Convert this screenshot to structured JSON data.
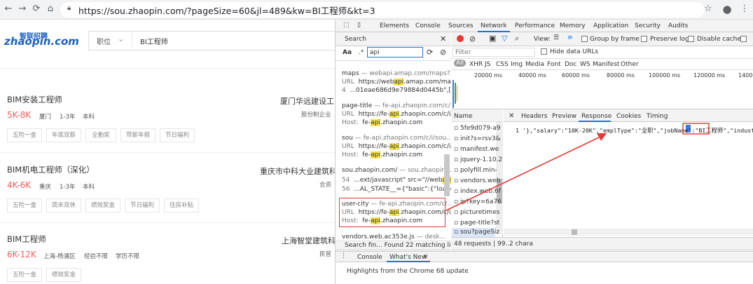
{
  "browser": {
    "url": "https://sou.zhaopin.com/?pageSize=60&jl=489&kw=BI工程师&kt=3"
  },
  "site": {
    "logo_main": "zhaopin.com",
    "logo_cn": "智联招聘",
    "search_category": "职位",
    "search_keyword": "BI工程师"
  },
  "jobs": [
    {
      "title": "BIM安装工程师",
      "salary": "5K-8K",
      "city": "厦门",
      "exp": "1-3年",
      "edu": "本科",
      "company": "厦门华远建设工",
      "company_sub": "股份制企业",
      "tags": [
        "五险一金",
        "年底双薪",
        "全勤奖",
        "带薪年假",
        "节日福利"
      ]
    },
    {
      "title": "BIM机电工程师（深化）",
      "salary": "4K-6K",
      "city": "重庆",
      "exp": "1-3年",
      "edu": "本科",
      "company": "重庆市中科大业建筑科",
      "company_sub": "合资",
      "tags": [
        "五险一金",
        "周末双休",
        "绩效奖金",
        "节日福利",
        "住房补贴"
      ]
    },
    {
      "title": "BIM工程师",
      "salary": "6K-12K",
      "city": "上海-杨浦区",
      "exp": "经验不限",
      "edu": "学历不限",
      "company": "上海智堂建筑科",
      "company_sub": "民营",
      "tags": [
        "五险一金",
        "绩效奖金"
      ]
    }
  ],
  "devtools": {
    "tabs": [
      "Elements",
      "Console",
      "Sources",
      "Network",
      "Performance",
      "Memory",
      "Application",
      "Security",
      "Audits"
    ],
    "active_tab": "Network",
    "search_label": "Search",
    "search_value": "api",
    "aa": "Aa",
    "regex": ".*",
    "results": [
      {
        "head": "maps",
        "src": " — webapi.amap.com/maps?...",
        "rows": [
          [
            "URL",
            "https://webapi.amap.com/ma..."
          ],
          [
            "4",
            "...01eae686d9e79884d0445b\",[11..."
          ]
        ]
      },
      {
        "head": "page-title",
        "src": " — fe-api.zhaopin.com/c/...",
        "rows": [
          [
            "URL",
            "https://fe-api.zhaopin.com/c/i/..."
          ],
          [
            "Host:",
            "fe-api.zhaopin.com"
          ]
        ]
      },
      {
        "head": "sou",
        "src": " — fe-api.zhaopin.com/c/i/sou...",
        "rows": [
          [
            "URL",
            "https://fe-api.zhaopin.com/c/i/..."
          ],
          [
            "Host:",
            "fe-api.zhaopin.com"
          ]
        ]
      },
      {
        "head": "sou.zhaopin.com/",
        "src": " — sou.zhaopin...",
        "rows": [
          [
            "54",
            "...ext/javascript\" src=\"//webapi.a..."
          ],
          [
            "56",
            "...AL_STATE__={\"basic\":{\"loaded\":..."
          ]
        ]
      },
      {
        "head": "user-city",
        "src": " — fe-api.zhaopin.com/c/...",
        "rows": [
          [
            "URL",
            "https://fe-api.zhaopin.com/c/i/..."
          ],
          [
            "Host:",
            "fe-api.zhaopin.com"
          ]
        ]
      },
      {
        "head": "vendors.web.ac353e.js",
        "src": " — desk...",
        "rows": []
      }
    ],
    "search_status": "Search fin...   Found 22 matching lines...",
    "toolbar": {
      "view": "View:",
      "group_by_frame": "Group by frame",
      "preserve_log": "Preserve log",
      "disable_cache": "Disable cache"
    },
    "filter_placeholder": "Filter",
    "hide_data_urls": "Hide data URLs",
    "types": [
      "All",
      "XHR",
      "JS",
      "CSS",
      "Img",
      "Media",
      "Font",
      "Doc",
      "WS",
      "Manifest",
      "Other"
    ],
    "timeline": [
      "20000 ms",
      "40000 ms",
      "60000 ms",
      "80000 ms",
      "100000 ms",
      "120000 ms",
      "14000"
    ],
    "name_header": "Name",
    "requests": [
      "5fe9d079-a9",
      "init?s=rsv3&",
      "manifest.we",
      "jquery-1.10.2",
      "polyfill.min-",
      "vendors.web",
      "index.web.6f",
      "ip?key=6a76",
      "picturetimes",
      "page-title?st",
      "sou?pageSiz"
    ],
    "detail_tabs": [
      "Headers",
      "Preview",
      "Response",
      "Cookies",
      "Timing"
    ],
    "active_detail": "Response",
    "response_text": "1  '},\"salary\":\"10K-20K\",\"emplType\":\"全职\",\"jobName\":\"BI工程师\",\"industry\":\"",
    "requests_status": "48 requests | 99...",
    "chars_status": "2 chara",
    "drawer_tabs": [
      "Console",
      "What's New"
    ],
    "drawer_text": "Highlights from the Chrome 68 update"
  },
  "colors": {
    "salary": "#fa5b5b",
    "highlight": "#f5e44a",
    "annotation": "#e53935",
    "active_tab": "#1a73e8"
  }
}
